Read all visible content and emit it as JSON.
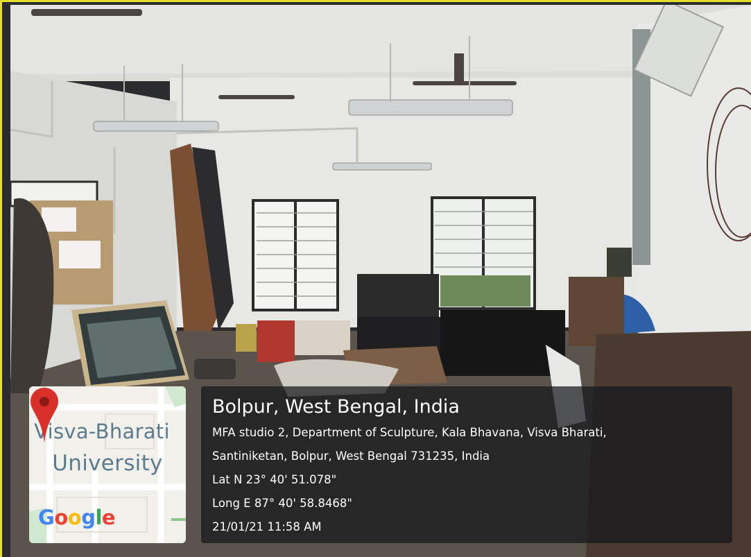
{
  "map": {
    "place_line1": "Visva-Bharati",
    "place_line2": "University",
    "logo": [
      "G",
      "o",
      "o",
      "g",
      "l",
      "e"
    ],
    "logo_colors": [
      "#4285F4",
      "#EA4335",
      "#FBBC05",
      "#4285F4",
      "#34A853",
      "#EA4335"
    ],
    "pin_color": "#D9302B",
    "pin_icon": "map-pin-icon"
  },
  "info": {
    "title": "Bolpur, West Bengal, India",
    "address_line1": "MFA studio 2, Department of Sculpture, Kala Bhavana, Visva Bharati,",
    "address_line2": "Santiniketan, Bolpur, West Bengal 731235, India",
    "latitude": "Lat N 23° 40' 51.078\"",
    "longitude": "Long E 87° 40' 58.8468\"",
    "timestamp": "21/01/21 11:58 AM"
  },
  "colors": {
    "frame_border": "#E6DC2A",
    "panel_bg": "rgba(20,22,26,0.72)",
    "text": "#FFFFFF"
  }
}
